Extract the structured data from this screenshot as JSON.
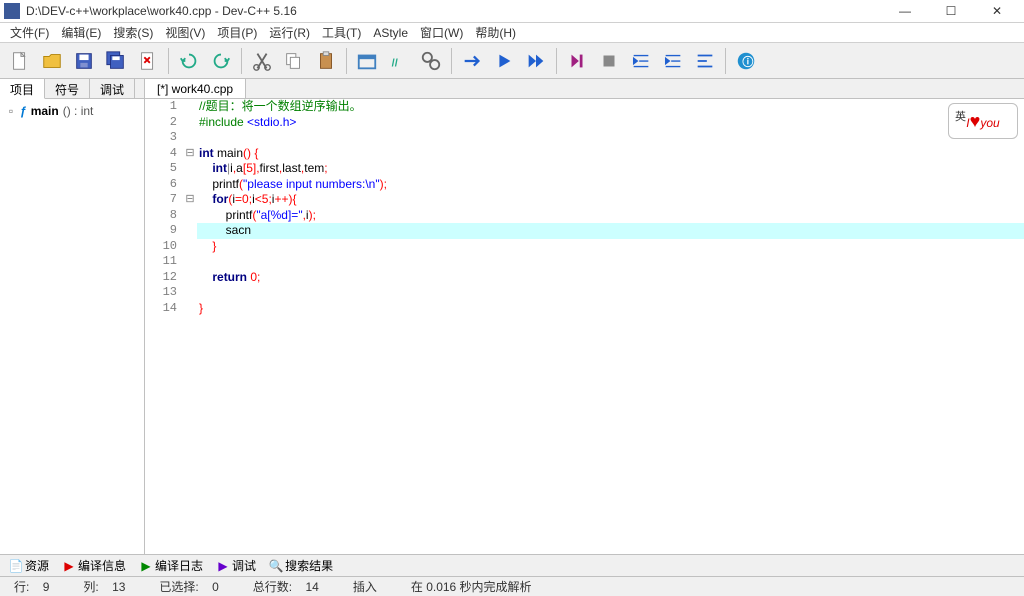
{
  "titlebar": {
    "path": "D:\\DEV-c++\\workplace\\work40.cpp - Dev-C++ 5.16"
  },
  "menubar": {
    "items": [
      "文件(F)",
      "编辑(E)",
      "搜索(S)",
      "视图(V)",
      "项目(P)",
      "运行(R)",
      "工具(T)",
      "AStyle",
      "窗口(W)",
      "帮助(H)"
    ]
  },
  "side_tabs": [
    "项目",
    "符号",
    "调试"
  ],
  "tree": {
    "fn_name": "main",
    "fn_sig": " () : int"
  },
  "editor_tab": "[*] work40.cpp",
  "code_lines": [
    {
      "n": 1,
      "fold": "",
      "cls": "",
      "html": "<span class='c-comment'>//题目：将一个数组逆序输出。</span>"
    },
    {
      "n": 2,
      "fold": "",
      "cls": "",
      "html": "<span class='c-pre'>#include</span> <span class='c-str'>&lt;stdio.h&gt;</span>"
    },
    {
      "n": 3,
      "fold": "",
      "cls": "",
      "html": ""
    },
    {
      "n": 4,
      "fold": "box",
      "cls": "",
      "html": "<span class='c-kw'>int</span> main<span class='c-punct'>()</span> <span class='c-punct'>{</span>"
    },
    {
      "n": 5,
      "fold": "",
      "cls": "",
      "html": "    <span class='c-kw'>int</span><span style='color:#888'>|</span>i<span class='c-punct'>,</span>a<span class='c-punct'>[</span><span class='c-num'>5</span><span class='c-punct'>],</span>first<span class='c-punct'>,</span>last<span class='c-punct'>,</span>tem<span class='c-punct'>;</span>"
    },
    {
      "n": 6,
      "fold": "",
      "cls": "",
      "html": "    printf<span class='c-punct'>(</span><span class='c-str'>\"please input numbers:\\n\"</span><span class='c-punct'>);</span>"
    },
    {
      "n": 7,
      "fold": "box",
      "cls": "",
      "html": "    <span class='c-kw'>for</span><span class='c-punct'>(</span>i<span class='c-punct'>=</span><span class='c-num'>0</span><span class='c-punct'>;</span>i<span class='c-punct'>&lt;</span><span class='c-num'>5</span><span class='c-punct'>;</span>i<span class='c-punct'>++){</span>"
    },
    {
      "n": 8,
      "fold": "",
      "cls": "",
      "html": "        printf<span class='c-punct'>(</span><span class='c-str'>\"a[%d]=\"</span><span class='c-punct'>,</span>i<span class='c-punct'>);</span>"
    },
    {
      "n": 9,
      "fold": "",
      "cls": "hl",
      "html": "        sacn"
    },
    {
      "n": 10,
      "fold": "",
      "cls": "",
      "html": "    <span class='c-punct'>}</span>"
    },
    {
      "n": 11,
      "fold": "",
      "cls": "",
      "html": ""
    },
    {
      "n": 12,
      "fold": "",
      "cls": "",
      "html": "    <span class='c-kw'>return</span> <span class='c-num'>0</span><span class='c-punct'>;</span>"
    },
    {
      "n": 13,
      "fold": "",
      "cls": "",
      "html": ""
    },
    {
      "n": 14,
      "fold": "",
      "cls": "",
      "html": "<span class='c-punct'>}</span>"
    }
  ],
  "bottom_tabs": [
    {
      "icon": "📄",
      "label": "资源"
    },
    {
      "icon": "▶",
      "label": "编译信息",
      "color": "#d00"
    },
    {
      "icon": "▶",
      "label": "编译日志",
      "color": "#080"
    },
    {
      "icon": "▶",
      "label": "调试",
      "color": "#60c"
    },
    {
      "icon": "🔍",
      "label": "搜索结果",
      "color": "#555"
    }
  ],
  "status": {
    "line_lbl": "行:",
    "line_val": "9",
    "col_lbl": "列:",
    "col_val": "13",
    "sel_lbl": "已选择:",
    "sel_val": "0",
    "total_lbl": "总行数:",
    "total_val": "14",
    "mode": "插入",
    "done": "在 0.016 秒内完成解析"
  },
  "watermark": {
    "char": "英",
    "text": "I ♥ you"
  }
}
